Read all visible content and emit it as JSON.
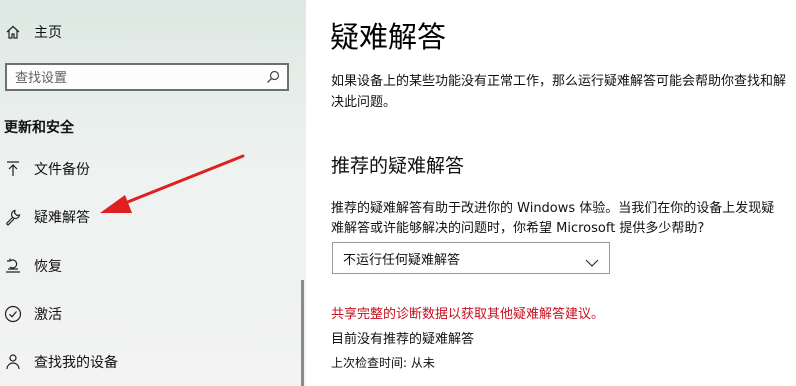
{
  "sidebar": {
    "home_label": "主页",
    "search_placeholder": "查找设置",
    "section_title": "更新和安全",
    "items": [
      {
        "label": "文件备份",
        "icon": "backup-arrow-icon"
      },
      {
        "label": "疑难解答",
        "icon": "wrench-icon"
      },
      {
        "label": "恢复",
        "icon": "recovery-icon"
      },
      {
        "label": "激活",
        "icon": "check-circle-icon"
      },
      {
        "label": "查找我的设备",
        "icon": "person-location-icon"
      }
    ]
  },
  "main": {
    "title": "疑难解答",
    "intro": "如果设备上的某些功能没有正常工作，那么运行疑难解答可能会帮助你查找和解决此问题。",
    "recommended_heading": "推荐的疑难解答",
    "recommended_desc": "推荐的疑难解答有助于改进你的 Windows 体验。当我们在你的设备上发现疑难解答或许能够解决的问题时，你希望 Microsoft 提供多少帮助?",
    "dropdown_value": "不运行任何疑难解答",
    "share_link": "共享完整的诊断数据以获取其他疑难解答建议。",
    "status": "目前没有推荐的疑难解答",
    "last_check": "上次检查时间: 从未"
  },
  "colors": {
    "annotation_arrow": "#e02020",
    "link_red": "#c50f1f"
  }
}
